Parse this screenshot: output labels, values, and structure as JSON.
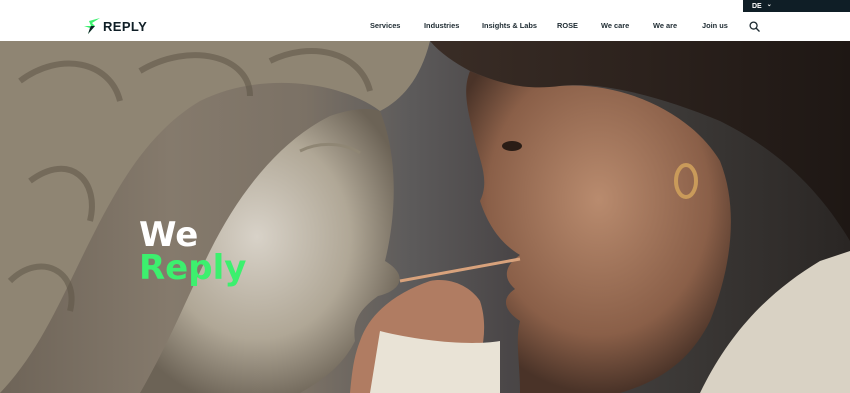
{
  "language": {
    "current": "DE"
  },
  "brand": {
    "name": "REPLY",
    "accent": "#3cf06e",
    "dark": "#0f1e26"
  },
  "nav": {
    "items": [
      {
        "label": "Services"
      },
      {
        "label": "Industries"
      },
      {
        "label": "Insights & Labs"
      },
      {
        "label": "ROSE"
      },
      {
        "label": "We care"
      },
      {
        "label": "We are"
      },
      {
        "label": "Join us"
      }
    ],
    "search_icon": "search-icon"
  },
  "hero": {
    "line1": "We",
    "line2": "Reply"
  }
}
